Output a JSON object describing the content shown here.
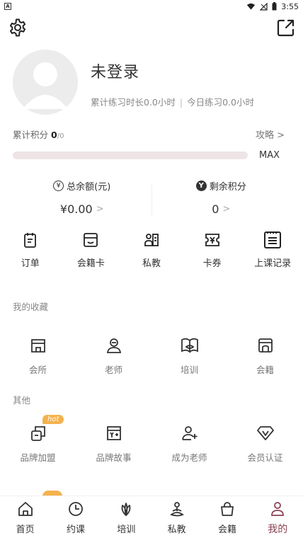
{
  "status_bar": {
    "time": "3:55",
    "app_letter": "A"
  },
  "profile": {
    "username": "未登录",
    "practice_total": "累计练习时长0.0小时",
    "separator": "|",
    "practice_today": "今日练习0.0小时"
  },
  "points": {
    "label": "累计积分",
    "value": "0",
    "total": "/0",
    "strategy_label": "攻略 >",
    "progress": 0,
    "max_label": "MAX"
  },
  "balance": {
    "total_label": "总余额(元)",
    "total_icon": "¥",
    "total_value": "¥0.00",
    "points_label": "剩余积分",
    "points_icon": "Y",
    "points_value": "0",
    "chevron": ">"
  },
  "quick_actions": [
    {
      "label": "订单",
      "icon": "order-icon"
    },
    {
      "label": "会籍卡",
      "icon": "membership-card-icon"
    },
    {
      "label": "私教",
      "icon": "private-coach-icon"
    },
    {
      "label": "卡券",
      "icon": "coupon-icon"
    },
    {
      "label": "上课记录",
      "icon": "class-record-icon"
    }
  ],
  "favorites": {
    "title": "我的收藏",
    "items": [
      {
        "label": "会所",
        "icon": "club-icon"
      },
      {
        "label": "老师",
        "icon": "teacher-icon"
      },
      {
        "label": "培训",
        "icon": "training-icon"
      },
      {
        "label": "会籍",
        "icon": "membership-icon"
      }
    ]
  },
  "others": {
    "title": "其他",
    "hot_label": "hot",
    "items": [
      {
        "label": "品牌加盟",
        "icon": "brand-join-icon"
      },
      {
        "label": "品牌故事",
        "icon": "brand-story-icon"
      },
      {
        "label": "成为老师",
        "icon": "become-teacher-icon"
      },
      {
        "label": "会员认证",
        "icon": "member-verify-icon"
      }
    ]
  },
  "tabbar": [
    {
      "label": "首页",
      "icon": "home-icon"
    },
    {
      "label": "约课",
      "icon": "clock-icon"
    },
    {
      "label": "培训",
      "icon": "lotus-icon"
    },
    {
      "label": "私教",
      "icon": "meditation-icon"
    },
    {
      "label": "会籍",
      "icon": "bag-icon"
    },
    {
      "label": "我的",
      "icon": "person-icon",
      "active": true
    }
  ],
  "colors": {
    "accent": "#8c4255",
    "hot": "#f4b24e",
    "progress_track": "#eee4e6"
  }
}
